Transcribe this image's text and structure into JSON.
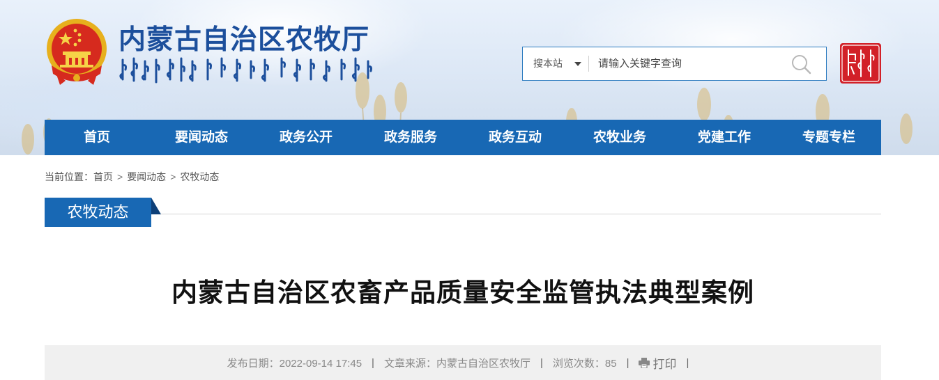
{
  "header": {
    "site_title": "内蒙古自治区农牧厅",
    "search": {
      "scope_label": "搜本站",
      "placeholder": "请输入关键字查询"
    },
    "icons": [
      "national-emblem-icon",
      "mongolian-script-title",
      "chevron-down-icon",
      "search-icon",
      "seal-logo-icon"
    ]
  },
  "nav": {
    "items": [
      {
        "label": "首页"
      },
      {
        "label": "要闻动态"
      },
      {
        "label": "政务公开"
      },
      {
        "label": "政务服务"
      },
      {
        "label": "政务互动"
      },
      {
        "label": "农牧业务"
      },
      {
        "label": "党建工作"
      },
      {
        "label": "专题专栏"
      }
    ]
  },
  "breadcrumb": {
    "prefix": "当前位置：",
    "items": [
      "首页",
      "要闻动态",
      "农牧动态"
    ],
    "separator": ">"
  },
  "section": {
    "title": "农牧动态"
  },
  "article": {
    "title": "内蒙古自治区农畜产品质量安全监管执法典型案例",
    "meta": {
      "publish_date": "发布日期：2022-09-14 17:45",
      "source": "文章来源：内蒙古自治区农牧厅",
      "views": "浏览次数：85",
      "print_label": "打印",
      "pipe": "|"
    }
  },
  "colors": {
    "nav_blue": "#1868b4",
    "title_blue": "#1c4f9c",
    "seal_red": "#d22028",
    "emblem_red": "#d62a1e",
    "emblem_gold": "#e7b01d"
  }
}
